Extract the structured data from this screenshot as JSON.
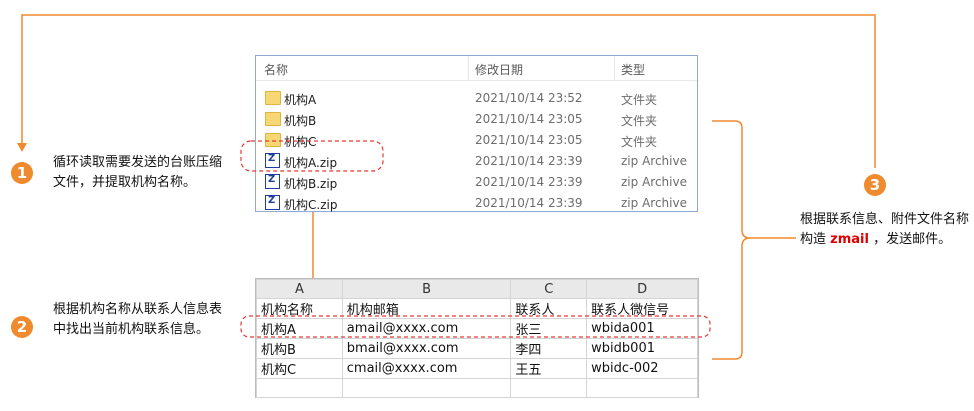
{
  "explorer": {
    "headers": {
      "name": "名称",
      "date": "修改日期",
      "type": "类型"
    },
    "files": [
      {
        "icon": "folder-icon",
        "name": "机构A",
        "date": "2021/10/14 23:52",
        "type": "文件夹"
      },
      {
        "icon": "folder-icon",
        "name": "机构B",
        "date": "2021/10/14 23:05",
        "type": "文件夹"
      },
      {
        "icon": "folder-icon",
        "name": "机构C",
        "date": "2021/10/14 23:05",
        "type": "文件夹"
      },
      {
        "icon": "zip-icon",
        "name": "机构A.zip",
        "date": "2021/10/14 23:39",
        "type": "zip Archive"
      },
      {
        "icon": "zip-icon",
        "name": "机构B.zip",
        "date": "2021/10/14 23:39",
        "type": "zip Archive"
      },
      {
        "icon": "zip-icon",
        "name": "机构C.zip",
        "date": "2021/10/14 23:39",
        "type": "zip Archive"
      }
    ]
  },
  "sheet": {
    "columns": [
      "A",
      "B",
      "C",
      "D"
    ],
    "rows": [
      [
        "机构名称",
        "机构邮箱",
        "联系人",
        "联系人微信号"
      ],
      [
        "机构A",
        "amail@xxxx.com",
        "张三",
        "wbida001"
      ],
      [
        "机构B",
        "bmail@xxxx.com",
        "李四",
        "wbidb001"
      ],
      [
        "机构C",
        "cmail@xxxx.com",
        "王五",
        "wbidc-002"
      ]
    ]
  },
  "steps": {
    "s1": {
      "num": "1",
      "text": "循环读取需要发送的台账压缩文件，并提取机构名称。"
    },
    "s2": {
      "num": "2",
      "text": "根据机构名称从联系人信息表中找出当前机构联系信息。"
    },
    "s3": {
      "num": "3",
      "text_before": "根据联系信息、附件文件名称构造 ",
      "highlight": "zmail",
      "text_after": " ，发送邮件。"
    }
  },
  "colors": {
    "accent": "#f08a2e",
    "highlight": "#e00000",
    "dashed": "#e53935"
  }
}
